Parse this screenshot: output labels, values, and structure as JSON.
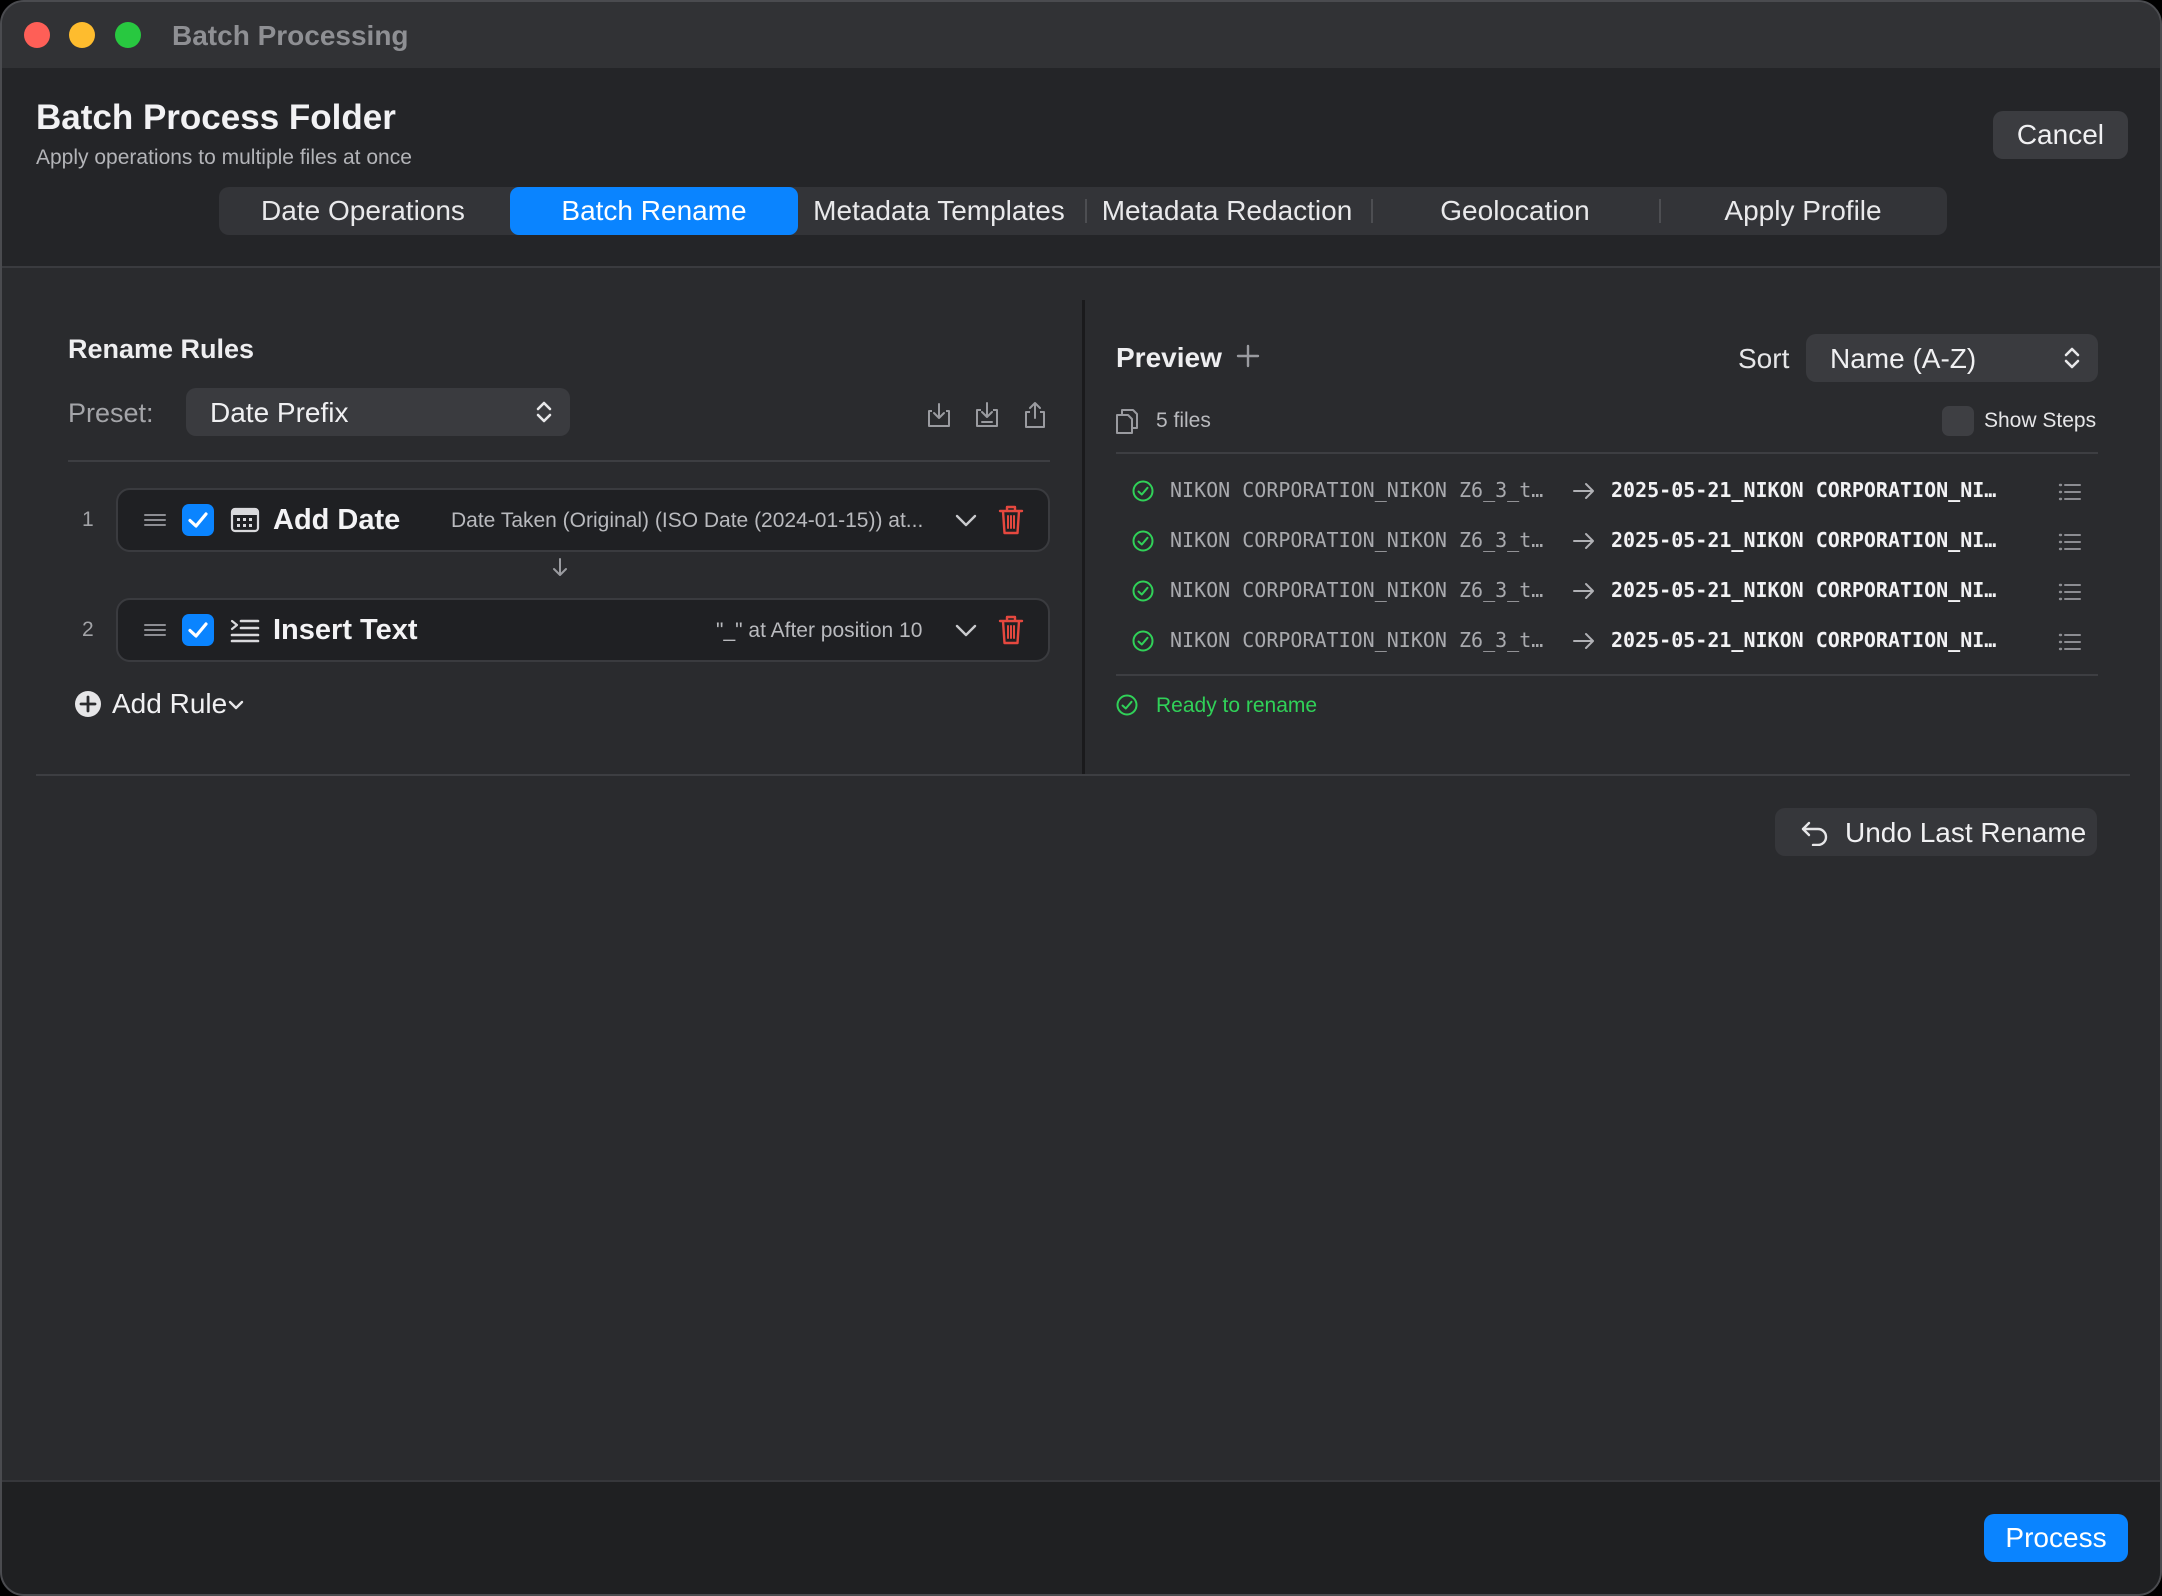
{
  "window": {
    "title": "Batch Processing"
  },
  "header": {
    "title": "Batch Process Folder",
    "subtitle": "Apply operations to multiple files at once",
    "cancel_label": "Cancel"
  },
  "tabs": [
    {
      "label": "Date Operations",
      "active": false
    },
    {
      "label": "Batch Rename",
      "active": true
    },
    {
      "label": "Metadata Templates",
      "active": false
    },
    {
      "label": "Metadata Redaction",
      "active": false
    },
    {
      "label": "Geolocation",
      "active": false
    },
    {
      "label": "Apply Profile",
      "active": false
    }
  ],
  "rules_panel": {
    "title": "Rename Rules",
    "preset_label": "Preset:",
    "preset_value": "Date Prefix",
    "rules": [
      {
        "index": "1",
        "enabled": true,
        "name": "Add Date",
        "icon": "calendar-icon",
        "detail": "Date Taken (Original) (ISO Date (2024-01-15)) at..."
      },
      {
        "index": "2",
        "enabled": true,
        "name": "Insert Text",
        "icon": "insert-text-icon",
        "detail": "\"_\" at After position 10"
      }
    ],
    "add_rule_label": "Add Rule"
  },
  "preview_panel": {
    "title": "Preview",
    "sort_label": "Sort",
    "sort_value": "Name (A-Z)",
    "files_count": "5 files",
    "show_steps_label": "Show Steps",
    "show_steps_on": false,
    "files": [
      {
        "old": "NIKON CORPORATION_NIKON Z6_3_t…",
        "new": "2025-05-21_NIKON CORPORATION_NI…"
      },
      {
        "old": "NIKON CORPORATION_NIKON Z6_3_t…",
        "new": "2025-05-21_NIKON CORPORATION_NI…"
      },
      {
        "old": "NIKON CORPORATION_NIKON Z6_3_t…",
        "new": "2025-05-21_NIKON CORPORATION_NI…"
      },
      {
        "old": "NIKON CORPORATION_NIKON Z6_3_t…",
        "new": "2025-05-21_NIKON CORPORATION_NI…"
      }
    ],
    "status": "Ready to rename"
  },
  "actions": {
    "undo_label": "Undo Last Rename",
    "process_label": "Process"
  },
  "colors": {
    "accent": "#0a84ff",
    "success": "#30d158",
    "danger": "#e5483f"
  }
}
